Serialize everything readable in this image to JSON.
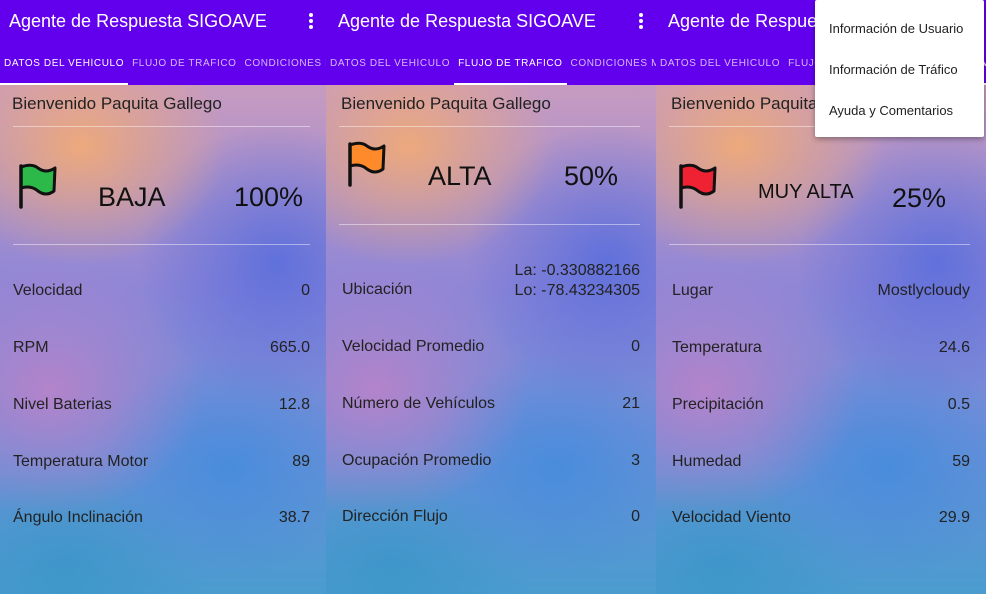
{
  "app": {
    "title": "Agente de Respuesta SIGOAVE"
  },
  "tabs": [
    "DATOS DEL VEHÍCULO",
    "FLUJO DE TRÁFICO",
    "CONDICIONES METEREOLÓGI…"
  ],
  "welcome": "Bienvenido Paquita Gallego",
  "panels": [
    {
      "active_tab": 0,
      "flag_color": "#2db84a",
      "level": "BAJA",
      "percent": "100%",
      "rows": [
        {
          "label": "Velocidad",
          "value": "0"
        },
        {
          "label": "RPM",
          "value": "665.0"
        },
        {
          "label": "Nivel Baterias",
          "value": "12.8"
        },
        {
          "label": "Temperatura Motor",
          "value": "89"
        },
        {
          "label": "Ángulo Inclinación",
          "value": "38.7"
        }
      ]
    },
    {
      "active_tab": 1,
      "flag_color": "#ff8a2b",
      "level": "ALTA",
      "percent": "50%",
      "location": {
        "label": "Ubicación",
        "lat": "La: -0.330882166",
        "lon": "Lo: -78.43234305"
      },
      "rows": [
        {
          "label": "Velocidad Promedio",
          "value": "0"
        },
        {
          "label": "Número de Vehículos",
          "value": "21"
        },
        {
          "label": "Ocupación Promedio",
          "value": "3"
        },
        {
          "label": "Dirección Flujo",
          "value": "0"
        }
      ]
    },
    {
      "active_tab": 2,
      "flag_color": "#ee2233",
      "level": "MUY ALTA",
      "percent": "25%",
      "rows": [
        {
          "label": "Lugar",
          "value": "Mostlycloudy"
        },
        {
          "label": "Temperatura",
          "value": "24.6"
        },
        {
          "label": "Precipitación",
          "value": "0.5"
        },
        {
          "label": "Humedad",
          "value": "59"
        },
        {
          "label": "Velocidad Viento",
          "value": "29.9"
        }
      ]
    }
  ],
  "overflow_menu": [
    "Información de Usuario",
    "Información de Tráfico",
    "Ayuda y Comentarios"
  ],
  "colors": {
    "primary": "#6200ee"
  }
}
